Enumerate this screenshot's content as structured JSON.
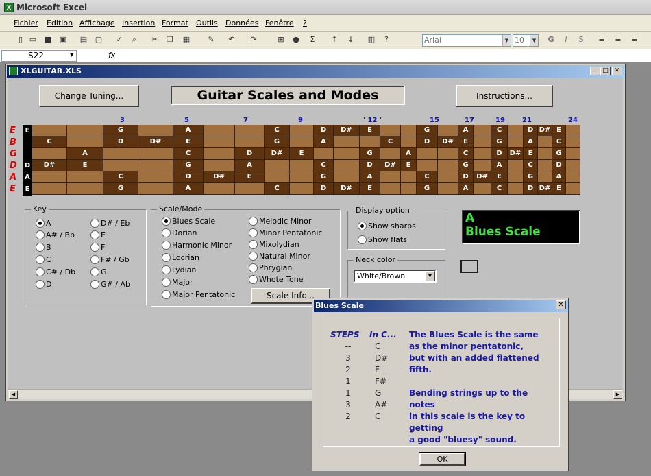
{
  "app": {
    "title": "Microsoft Excel",
    "icon_letter": "X"
  },
  "menu": [
    "Fichier",
    "Edition",
    "Affichage",
    "Insertion",
    "Format",
    "Outils",
    "Données",
    "Fenêtre",
    "?"
  ],
  "toolbar": {
    "font_name": "Arial",
    "font_size": "10",
    "bold": "G",
    "italic": "I",
    "underline": "S",
    "sigma": "Σ"
  },
  "formula_bar": {
    "cell_ref": "S22",
    "fx": "fx"
  },
  "workbook": {
    "title": "XLGUITAR.XLS"
  },
  "buttons": {
    "change_tuning": "Change Tuning...",
    "instructions": "Instructions...",
    "scale_info": "Scale Info..."
  },
  "sheet_title": "Guitar Scales and Modes",
  "fret_markers": [
    {
      "label": "3"
    },
    {
      "label": "5"
    },
    {
      "label": "7"
    },
    {
      "label": "9"
    },
    {
      "label": "' 12 '"
    },
    {
      "label": "15"
    },
    {
      "label": "17"
    },
    {
      "label": "19"
    },
    {
      "label": "21"
    },
    {
      "label": "24"
    }
  ],
  "strings": [
    "E",
    "B",
    "G",
    "D",
    "A",
    "E"
  ],
  "open_notes": [
    "E",
    "",
    "",
    "D",
    "A",
    "E"
  ],
  "fretboard": [
    [
      "",
      "",
      "G",
      "",
      "A",
      "",
      "",
      "C",
      "",
      "D",
      "D#",
      "E",
      "",
      "",
      "G",
      "",
      "A",
      "",
      "C",
      "",
      "D",
      "D#",
      "E",
      ""
    ],
    [
      "C",
      "",
      "D",
      "D#",
      "E",
      "",
      "",
      "G",
      "",
      "A",
      "",
      "",
      "C",
      "",
      "D",
      "D#",
      "E",
      "",
      "G",
      "",
      "A",
      "",
      "C",
      ""
    ],
    [
      "",
      "A",
      "",
      "",
      "C",
      "",
      "D",
      "D#",
      "E",
      "",
      "",
      "G",
      "",
      "A",
      "",
      "",
      "C",
      "",
      "D",
      "D#",
      "E",
      "",
      "G",
      ""
    ],
    [
      "D#",
      "E",
      "",
      "",
      "G",
      "",
      "A",
      "",
      "",
      "C",
      "",
      "D",
      "D#",
      "E",
      "",
      "",
      "G",
      "",
      "A",
      "",
      "C",
      "",
      "D",
      ""
    ],
    [
      "",
      "",
      "C",
      "",
      "D",
      "D#",
      "E",
      "",
      "",
      "G",
      "",
      "A",
      "",
      "",
      "C",
      "",
      "D",
      "D#",
      "E",
      "",
      "G",
      "",
      "A",
      ""
    ],
    [
      "",
      "",
      "G",
      "",
      "A",
      "",
      "",
      "C",
      "",
      "D",
      "D#",
      "E",
      "",
      "",
      "G",
      "",
      "A",
      "",
      "C",
      "",
      "D",
      "D#",
      "E",
      ""
    ]
  ],
  "key_group": {
    "label": "Key",
    "options": [
      "A",
      "A# / Bb",
      "B",
      "C",
      "C# / Db",
      "D",
      "D# / Eb",
      "E",
      "F",
      "F# / Gb",
      "G",
      "G# / Ab"
    ],
    "selected": "A"
  },
  "scale_group": {
    "label": "Scale/Mode",
    "options": [
      "Blues Scale",
      "Dorian",
      "Harmonic Minor",
      "Locrian",
      "Lydian",
      "Major",
      "Major Pentatonic",
      "Melodic Minor",
      "Minor Pentatonic",
      "Mixolydian",
      "Natural Minor",
      "Phrygian",
      "Whote Tone"
    ],
    "selected": "Blues Scale"
  },
  "display_group": {
    "label": "Display option",
    "options": [
      "Show sharps",
      "Show flats"
    ],
    "selected": "Show sharps"
  },
  "neck_group": {
    "label": "Neck color",
    "value": "White/Brown"
  },
  "display_panel": {
    "key": "A",
    "scale": "Blues Scale"
  },
  "dialog": {
    "title": "Blues Scale",
    "steps_header": "STEPS",
    "inc_header": "In C...",
    "steps": [
      "--",
      "3",
      "2",
      "1",
      "1",
      "3",
      "2"
    ],
    "notes": [
      "C",
      "D#",
      "F",
      "F#",
      "G",
      "A#",
      "C"
    ],
    "desc_lines": [
      "The Blues Scale is the same",
      "as the minor pentatonic,",
      "but with an added flattened",
      "fifth.",
      "",
      "Bending strings up to the notes",
      "in this scale is the key to getting",
      "a good \"bluesy\" sound."
    ],
    "ok": "OK"
  },
  "colors": {
    "fret_light": "#a0703f",
    "fret_dark": "#5e3410",
    "marker_blue": "#1010c0",
    "string_red": "#e00000",
    "display_green": "#3ee03e",
    "dialog_text": "#1a1aa0"
  }
}
